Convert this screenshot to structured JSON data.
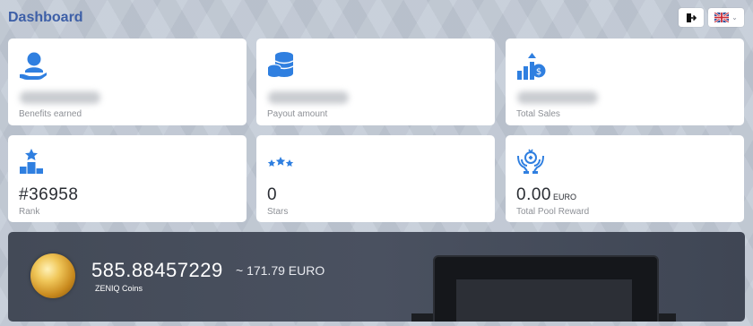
{
  "header": {
    "title": "Dashboard"
  },
  "language": {
    "flag": "uk-flag",
    "chevron": "chevron-down-icon"
  },
  "cards": [
    {
      "icon": "hand-user-icon",
      "value_hidden": true,
      "label": "Benefits earned"
    },
    {
      "icon": "coin-stack-icon",
      "value_hidden": true,
      "label": "Payout amount"
    },
    {
      "icon": "sales-growth-icon",
      "value_hidden": true,
      "label": "Total Sales"
    },
    {
      "icon": "podium-icon",
      "value": "#36958",
      "label": "Rank"
    },
    {
      "icon": "stars-icon",
      "value": "0",
      "label": "Stars"
    },
    {
      "icon": "pool-reward-icon",
      "value": "0.00",
      "unit": "EURO",
      "label": "Total Pool Reward"
    }
  ],
  "banner": {
    "coin_value": "585.88457229",
    "euro_value": "~ 171.79 EURO",
    "coin_label": "ZENIQ Coins"
  },
  "colors": {
    "accent": "#2f7fe0",
    "title": "#3d5fa7",
    "banner": "#454c5a"
  }
}
